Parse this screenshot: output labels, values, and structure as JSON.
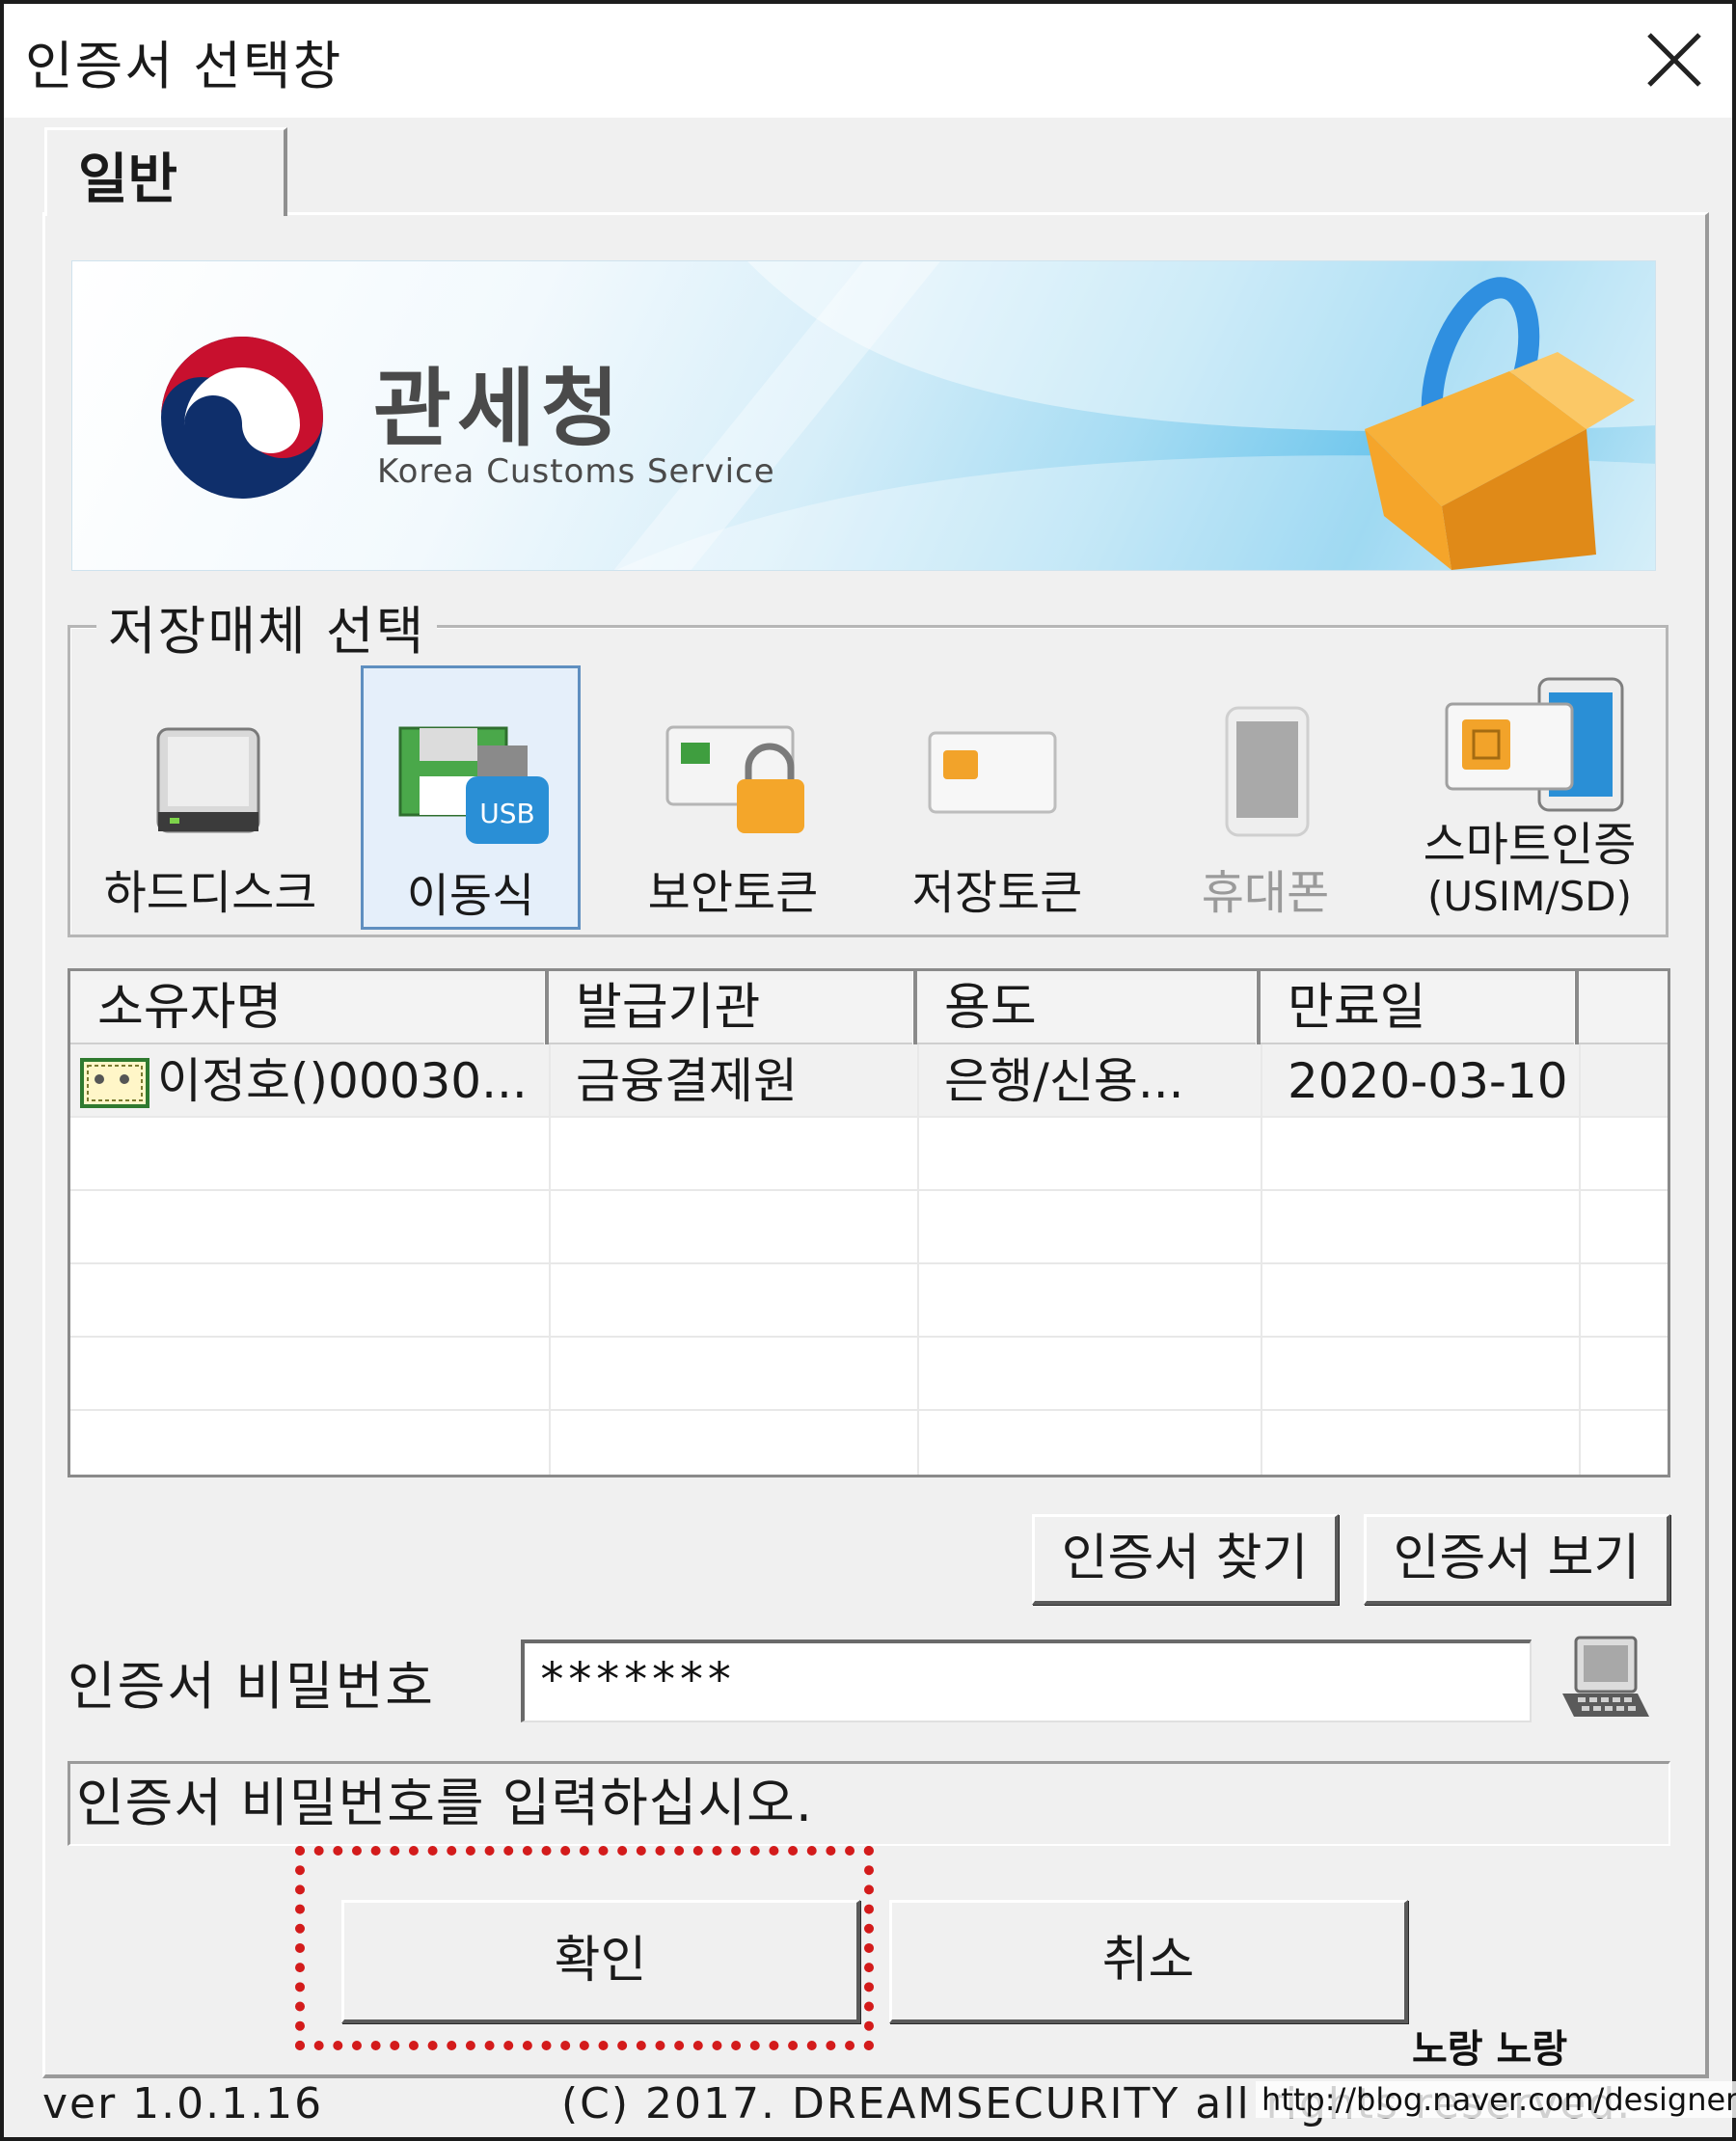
{
  "window": {
    "title": "인증서 선택창"
  },
  "tabs": [
    {
      "label": "일반"
    }
  ],
  "banner": {
    "org_name_ko": "관세청",
    "org_name_en": "Korea Customs Service"
  },
  "storage": {
    "legend": "저장매체 선택",
    "items": [
      {
        "label": "하드디스크",
        "icon": "hard-disk-icon",
        "state": "normal"
      },
      {
        "label": "이동식",
        "icon": "usb-drive-icon",
        "state": "selected"
      },
      {
        "label": "보안토큰",
        "icon": "security-token-icon",
        "state": "normal"
      },
      {
        "label": "저장토큰",
        "icon": "storage-token-icon",
        "state": "normal"
      },
      {
        "label": "휴대폰",
        "icon": "mobile-phone-icon",
        "state": "disabled"
      },
      {
        "label": "스마트인증",
        "label2": "(USIM/SD)",
        "icon": "smart-auth-icon",
        "state": "normal"
      }
    ]
  },
  "cert_list": {
    "columns": [
      "소유자명",
      "발급기관",
      "용도",
      "만료일"
    ],
    "rows": [
      {
        "owner": "이정호()00030...",
        "issuer": "금융결제원",
        "purpose": "은행/신용...",
        "expiry": "2020-03-10"
      }
    ]
  },
  "actions": {
    "find_cert": "인증서 찾기",
    "view_cert": "인증서 보기"
  },
  "password": {
    "label": "인증서 비밀번호",
    "value": "*******"
  },
  "status_message": "인증서 비밀번호를 입력하십시오.",
  "buttons": {
    "ok": "확인",
    "cancel": "취소"
  },
  "footer": {
    "version": "ver 1.0.1.16",
    "copyright": "(C) 2017. DREAMSECURITY all rights reserved."
  },
  "watermark": {
    "name": "노랑 노랑",
    "url": "http://blog.naver.com/designer_ew"
  },
  "colors": {
    "selected_border": "#5f8fc0",
    "highlight_dotted": "#d31b1b",
    "usb_badge": "#2a8fd6",
    "lock_orange": "#f4a62a"
  }
}
